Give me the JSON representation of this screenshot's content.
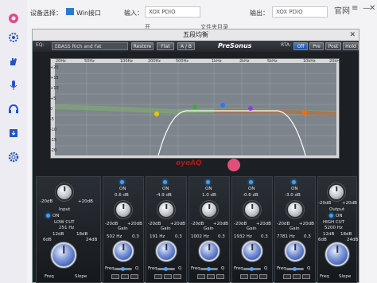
{
  "topbar": {
    "device_label": "设备选择：",
    "device_value": "Win接口",
    "input_label": "输入：",
    "input_value": "XOX PDIO",
    "output_label": "输出：",
    "output_value": "XOX PDIO",
    "website_link": "官网"
  },
  "subrow": {
    "opt1": "开",
    "opt2": "文件夹目录"
  },
  "eq": {
    "window_title": "五段均衡",
    "close": "✕",
    "eq_label": "EQ:",
    "preset": "EBASS Rich and Fat",
    "restore": "Restore",
    "flat": "Flat",
    "ab": "A / B",
    "brand": "PreSonus",
    "rta_label": "RTA:",
    "rta_off": "Off",
    "rta_pre": "Pre",
    "rta_post": "Post",
    "rta_hold": "Hold",
    "logo": "eyeAQ",
    "freq_labels": [
      "20Hz",
      "50Hz",
      "100Hz",
      "200Hz",
      "500Hz",
      "1kHz",
      "2kHz",
      "5kHz",
      "10kHz",
      "20kHz"
    ],
    "db_labels": [
      "+20",
      "+15",
      "+10",
      "+5",
      "0",
      "-5",
      "-10",
      "-15",
      "-20"
    ]
  },
  "bands": {
    "input": {
      "label": "Input",
      "db_min": "-20dB",
      "db_max": "+20dB"
    },
    "lowcut": {
      "on": "ON",
      "title": "LOW CUT",
      "value": "251 Hz",
      "db6": "6dB",
      "db12": "12dB",
      "db18": "18dB",
      "db24": "24dB",
      "freq": "Freq",
      "slope": "Slope"
    },
    "b1": {
      "on": "ON",
      "gain_value": "0.6 dB",
      "gain": "Gain",
      "freq_value": "502 Hz",
      "q_value": "0.3",
      "freq": "Freq",
      "q": "Q",
      "min": "-20dB",
      "max": "+20dB"
    },
    "b2": {
      "on": "ON",
      "gain_value": "-4.9 dB",
      "gain": "Gain",
      "freq_value": "191 Hz",
      "q_value": "0.3",
      "freq": "Freq",
      "q": "Q",
      "min": "-20dB",
      "max": "+20dB"
    },
    "b3": {
      "on": "ON",
      "gain_value": "1.0 dB",
      "gain": "Gain",
      "freq_value": "1002 Hz",
      "q_value": "0.3",
      "freq": "Freq",
      "q": "Q",
      "min": "-20dB",
      "max": "+20dB"
    },
    "b4": {
      "on": "ON",
      "gain_value": "-0.6 dB",
      "gain": "Gain",
      "freq_value": "1932 Hz",
      "q_value": "0.3",
      "freq": "Freq",
      "q": "Q",
      "min": "-20dB",
      "max": "+20dB"
    },
    "b5": {
      "on": "ON",
      "gain_value": "-3.0 dB",
      "gain": "Gain",
      "freq_value": "7781 Hz",
      "q_value": "0.3",
      "freq": "Freq",
      "q": "Q",
      "min": "-20dB",
      "max": "+20dB"
    },
    "output": {
      "label": "Output",
      "db_min": "-20dB",
      "db_max": "+20dB"
    },
    "highcut": {
      "on": "ON",
      "title": "HIGH CUT",
      "value": "5200 Hz",
      "db6": "6dB",
      "db12": "12dB",
      "db18": "18dB",
      "db24": "24dB",
      "freq": "Freq",
      "slope": "Slope"
    }
  },
  "colors": {
    "accent": "#3aa7ff",
    "band1": "#f2c200",
    "band2": "#3ea93a",
    "band3": "#2a75ff",
    "band4": "#8a3ee0",
    "band5": "#f26a14"
  }
}
